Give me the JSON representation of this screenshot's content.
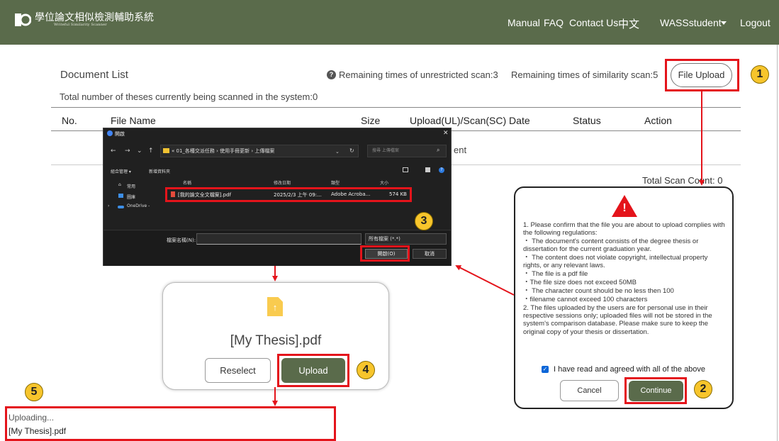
{
  "header": {
    "logo_title": "學位論文相似檢測輔助系統",
    "logo_subtitle": "Writeful Similarity Scanner",
    "nav": [
      "Manual",
      "FAQ",
      "Contact Us",
      "中文"
    ],
    "user": "WASSstudent",
    "logout": "Logout",
    "brand_color": "#5a6b4b"
  },
  "doc_list": {
    "title": "Document List",
    "scan_count_note": "Total number of theses currently being scanned in the system:0",
    "unrestricted": "Remaining times of unrestricted scan:3",
    "similarity": "Remaining times of similarity scan:5",
    "file_upload": "File Upload",
    "columns": [
      "No.",
      "File Name",
      "Size",
      "Upload(UL)/Scan(SC) Date",
      "Status",
      "Action"
    ],
    "empty_fragment": "ent",
    "total_scan": "Total Scan Count: 0"
  },
  "badges": [
    "1",
    "2",
    "3",
    "4",
    "5"
  ],
  "file_dialog": {
    "title": "開啟",
    "path": "« 01_各種交派任務 › 使用手冊更新 › 上傳檔案",
    "search_placeholder": "搜尋 上傳檔案",
    "organize": "組合管理 ▾",
    "new_folder": "新增資料夾",
    "columns": [
      "名稱",
      "修改日期",
      "類型",
      "大小"
    ],
    "sidebar": [
      "常用",
      "圖庫",
      "OneDrive -"
    ],
    "file": {
      "name": "[我的論文全文檔案].pdf",
      "date": "2025/2/3 上午 09:...",
      "type": "Adobe Acroba...",
      "size": "574 KB"
    },
    "filename_label": "檔案名稱(N):",
    "file_type": "所有檔案 (*.*)",
    "open": "開啟(O)",
    "cancel": "取消"
  },
  "upload_card": {
    "filename": "[My Thesis].pdf",
    "reselect": "Reselect",
    "upload": "Upload"
  },
  "uploading": {
    "status": "Uploading...",
    "filename": "[My Thesis].pdf"
  },
  "confirm": {
    "lines": [
      "1. Please confirm that the file you are about to upload complies with the following regulations:",
      "・ The document's content consists of the degree thesis or dissertation for the current graduation year.",
      "・ The content does not violate copyright, intellectual property rights, or any relevant laws.",
      "・ The file is a pdf file",
      "・The file size does not exceed 50MB",
      "・ The character count should be no less then 100",
      "・filename cannot exceed 100 characters",
      "2. The files uploaded by the users are for personal use in their respective sessions only; uploaded files will not be stored in the system's comparison database. Please make sure to keep the original copy of your thesis or dissertation."
    ],
    "agree": "I have read and agreed with all of the above",
    "cancel": "Cancel",
    "continue": "Continue"
  }
}
